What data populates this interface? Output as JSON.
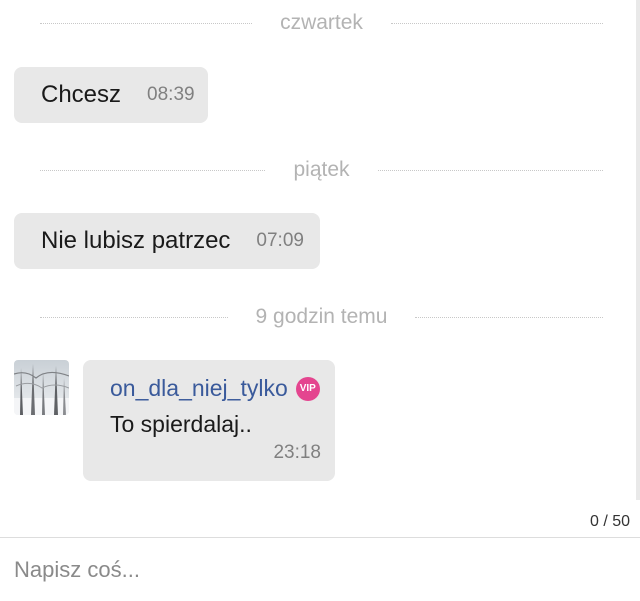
{
  "dividers": {
    "d1": "czwartek",
    "d2": "piątek",
    "d3": "9 godzin temu"
  },
  "messages": {
    "m1": {
      "text": "Chcesz",
      "time": "08:39"
    },
    "m2": {
      "text": "Nie lubisz patrzec",
      "time": "07:09"
    },
    "m3": {
      "sender": "on_dla_niej_tylko",
      "badge": "VIP",
      "text": "To spierdalaj..",
      "time": "23:18"
    }
  },
  "composer": {
    "counter": "0 / 50",
    "placeholder": "Napisz coś..."
  },
  "colors": {
    "bubble": "#e8e8e8",
    "sender_name": "#3a5a9b",
    "vip_badge": "#e4458f",
    "divider_text": "#b3b3b3"
  }
}
